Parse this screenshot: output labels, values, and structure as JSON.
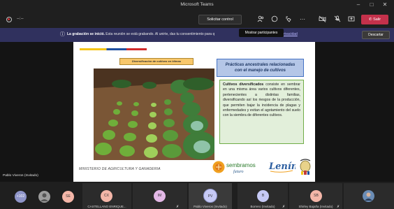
{
  "window": {
    "title": "Microsoft Teams"
  },
  "toolbar": {
    "timer": "--:--",
    "request_control": "Solicitar control",
    "leave": "Salir",
    "tooltip": "Mostrar participantes"
  },
  "banner": {
    "bold": "La grabación se inició.",
    "text": " Esta reunión se está grabando. Al unirte, das tu consentimiento para q",
    "link": "privacidad",
    "dismiss": "Descartar"
  },
  "slide": {
    "caption": "Diversificación de cultivos en hileras",
    "title_line1": "Prácticas ancestrales relacionadas",
    "title_line2": "con el manejo de cultivos",
    "body_bold": "Cultivos diversificados",
    "body_rest": " consiste en sembrar en una misma área varios cultivos diferentes, pertenecientes a distintas familias, diversificando así los riesgos de la producción, que permiten bajar la incidencia de plagas y enfermedades y evitan el agotamiento del suelo con la siembra de diferentes cultivos.",
    "ministry": "MINISTERIO DE AGRICULTURA Y GANADERIA",
    "logo_sembramos": "sembramos",
    "logo_futuro": "futuro",
    "logo_lenin": "Lenín"
  },
  "stage": {
    "self_label": "Pablo Viveros (Invitado)"
  },
  "participants": [
    {
      "initials": "+102",
      "name": "",
      "color": "#8f95c9"
    },
    {
      "initials": "",
      "name": "",
      "color": "#9c9c9c"
    },
    {
      "initials": "SE",
      "name": "",
      "color": "#f4b6a8"
    },
    {
      "initials": "CX",
      "name": "CASTELLANO ENRIQUE...",
      "color": "#f4b6a8"
    },
    {
      "initials": "IM",
      "name": "",
      "color": "#e3b8e6"
    },
    {
      "initials": "PV",
      "name": "Pablo Viveros (Invitado)",
      "color": "#c6c9f5"
    },
    {
      "initials": "B",
      "name": "Borrero (Invitado)",
      "color": "#c6c9f5"
    },
    {
      "initials": "SB",
      "name": "Shirley Bajaña (Invitado)",
      "color": "#f4b6a8"
    },
    {
      "initials": "",
      "name": "",
      "color": "#6a8cb5"
    }
  ],
  "colors": {
    "banner_bg": "#30315e",
    "leave_button": "#c4314b",
    "slide_title_bg": "#b4c6e7",
    "slide_body_bg": "#e2efda"
  },
  "icons": [
    "record-icon",
    "people-icon",
    "chat-icon",
    "reactions-icon",
    "more-icon",
    "camera-off-icon",
    "mic-off-icon",
    "share-icon",
    "phone-icon",
    "info-icon",
    "minimize-icon",
    "maximize-icon",
    "close-icon"
  ]
}
